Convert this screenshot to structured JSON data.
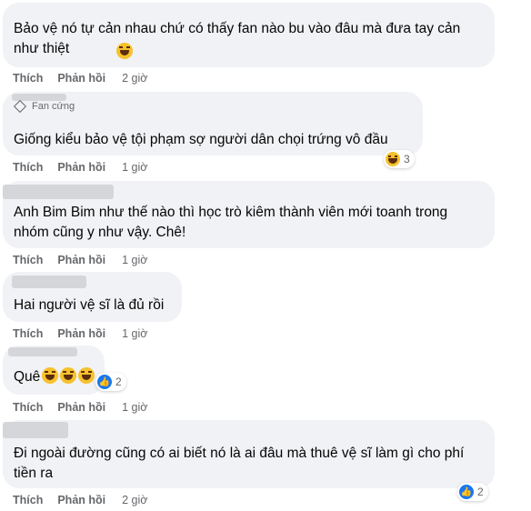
{
  "action_labels": {
    "like": "Thích",
    "reply": "Phản hồi"
  },
  "comments": [
    {
      "text": "Bảo vệ nó tự cản nhau chứ có thấy fan nào bu vào đâu mà đưa tay cản như thiệt",
      "time": "2 giờ"
    },
    {
      "badge": "Fan cứng",
      "text": "Giống kiểu bảo vệ tội phạm sợ người dân chọi trứng vô đầu",
      "time": "1 giờ",
      "reaction_count": "3"
    },
    {
      "text": "Anh Bim Bim như thế nào thì học trò kiêm thành viên mới toanh trong nhóm cũng y như vậy. Chê!",
      "time": "1 giờ"
    },
    {
      "text": "Hai người vệ sĩ là đủ rồi",
      "time": "1 giờ"
    },
    {
      "text": "Quê",
      "time": "1 giờ",
      "reaction_count": "2"
    },
    {
      "text": "Đi ngoài đường cũng có ai biết nó là ai đâu mà thuê vệ sĩ làm gì cho phí tiền ra",
      "time": "2 giờ",
      "reaction_count": "2"
    }
  ],
  "colors": {
    "bubble": "#f0f2f5",
    "meta": "#65676b",
    "like_blue": "#1877f2",
    "haha_yellow": "#f7c12c"
  }
}
